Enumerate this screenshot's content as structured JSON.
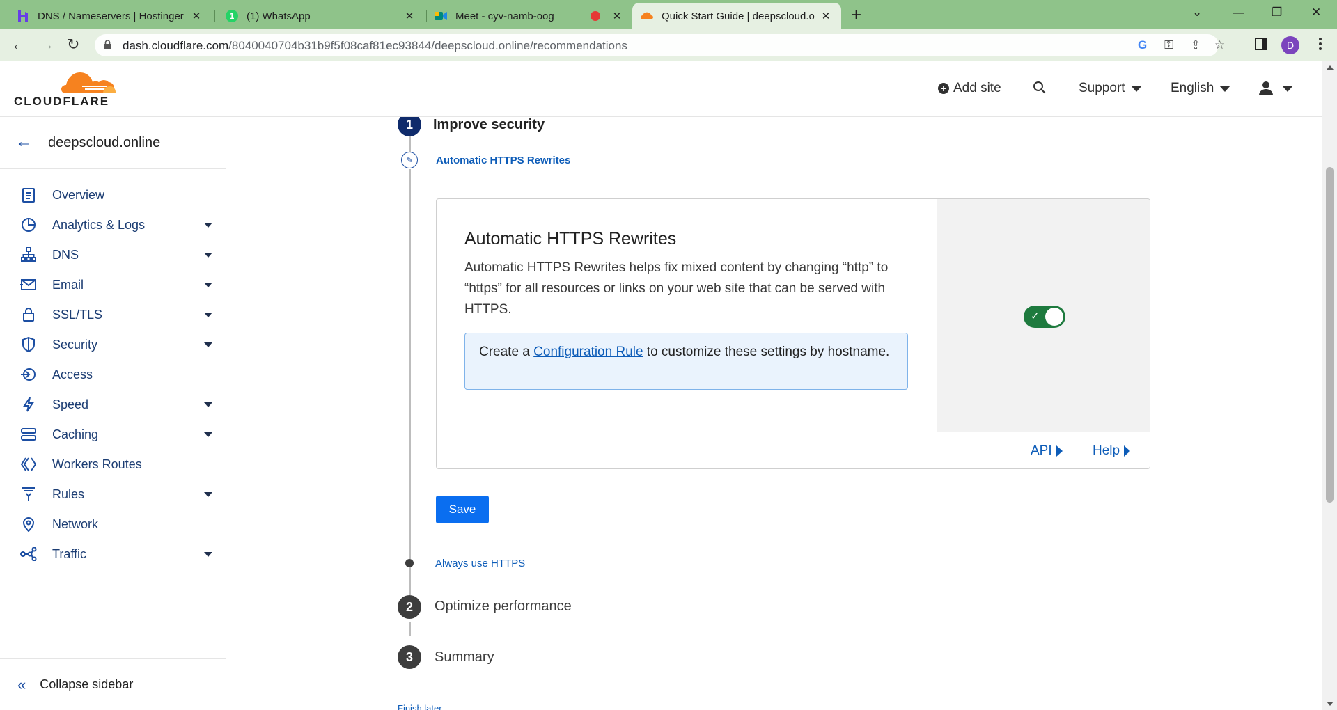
{
  "browser": {
    "tabs": [
      {
        "title": "DNS / Nameservers | Hostinger",
        "favicon": "hostinger-icon"
      },
      {
        "title": "(1) WhatsApp",
        "favicon": "whatsapp-icon",
        "badge": "1"
      },
      {
        "title": "Meet - cyv-namb-oog",
        "favicon": "google-meet-icon"
      },
      {
        "title": "Quick Start Guide | deepscloud.o",
        "favicon": "cloudflare-icon",
        "active": true
      }
    ],
    "url_domain": "dash.cloudflare.com",
    "url_path": "/8040040704b31b9f5f08caf81ec93844/deepscloud.online/recommendations",
    "profile_initial": "D"
  },
  "header": {
    "logo_text": "CLOUDFLARE",
    "add_site": "Add site",
    "support": "Support",
    "language": "English"
  },
  "sidebar": {
    "site_name": "deepscloud.online",
    "items": [
      {
        "label": "Overview",
        "icon": "document-icon",
        "dropdown": false
      },
      {
        "label": "Analytics & Logs",
        "icon": "pie-chart-icon",
        "dropdown": true
      },
      {
        "label": "DNS",
        "icon": "network-tree-icon",
        "dropdown": true
      },
      {
        "label": "Email",
        "icon": "envelope-icon",
        "dropdown": true
      },
      {
        "label": "SSL/TLS",
        "icon": "lock-icon",
        "dropdown": true
      },
      {
        "label": "Security",
        "icon": "shield-icon",
        "dropdown": true
      },
      {
        "label": "Access",
        "icon": "access-icon",
        "dropdown": false
      },
      {
        "label": "Speed",
        "icon": "lightning-icon",
        "dropdown": true
      },
      {
        "label": "Caching",
        "icon": "server-stack-icon",
        "dropdown": true
      },
      {
        "label": "Workers Routes",
        "icon": "diamond-icon",
        "dropdown": false
      },
      {
        "label": "Rules",
        "icon": "funnel-icon",
        "dropdown": true
      },
      {
        "label": "Network",
        "icon": "location-pin-icon",
        "dropdown": false
      },
      {
        "label": "Traffic",
        "icon": "share-nodes-icon",
        "dropdown": true
      }
    ],
    "collapse_label": "Collapse sidebar"
  },
  "main": {
    "step1": {
      "number": "1",
      "title": "Improve security"
    },
    "substep_active": "Automatic HTTPS Rewrites",
    "card": {
      "title": "Automatic HTTPS Rewrites",
      "description": "Automatic HTTPS Rewrites helps fix mixed content by changing “http” to “https” for all resources or links on your web site that can be served with HTTPS.",
      "info_prefix": "Create a ",
      "info_link": "Configuration Rule",
      "info_suffix": " to customize these settings by hostname.",
      "toggle_on": true,
      "api_link": "API",
      "help_link": "Help"
    },
    "save_label": "Save",
    "substep_next": "Always use HTTPS",
    "step2": {
      "number": "2",
      "title": "Optimize performance"
    },
    "step3": {
      "number": "3",
      "title": "Summary"
    },
    "finish_later": "Finish later"
  },
  "colors": {
    "accent": "#0a6ef0",
    "toggle_on": "#1e7a3e",
    "link": "#0d5cb8",
    "cloudflare_orange": "#f6821f"
  }
}
